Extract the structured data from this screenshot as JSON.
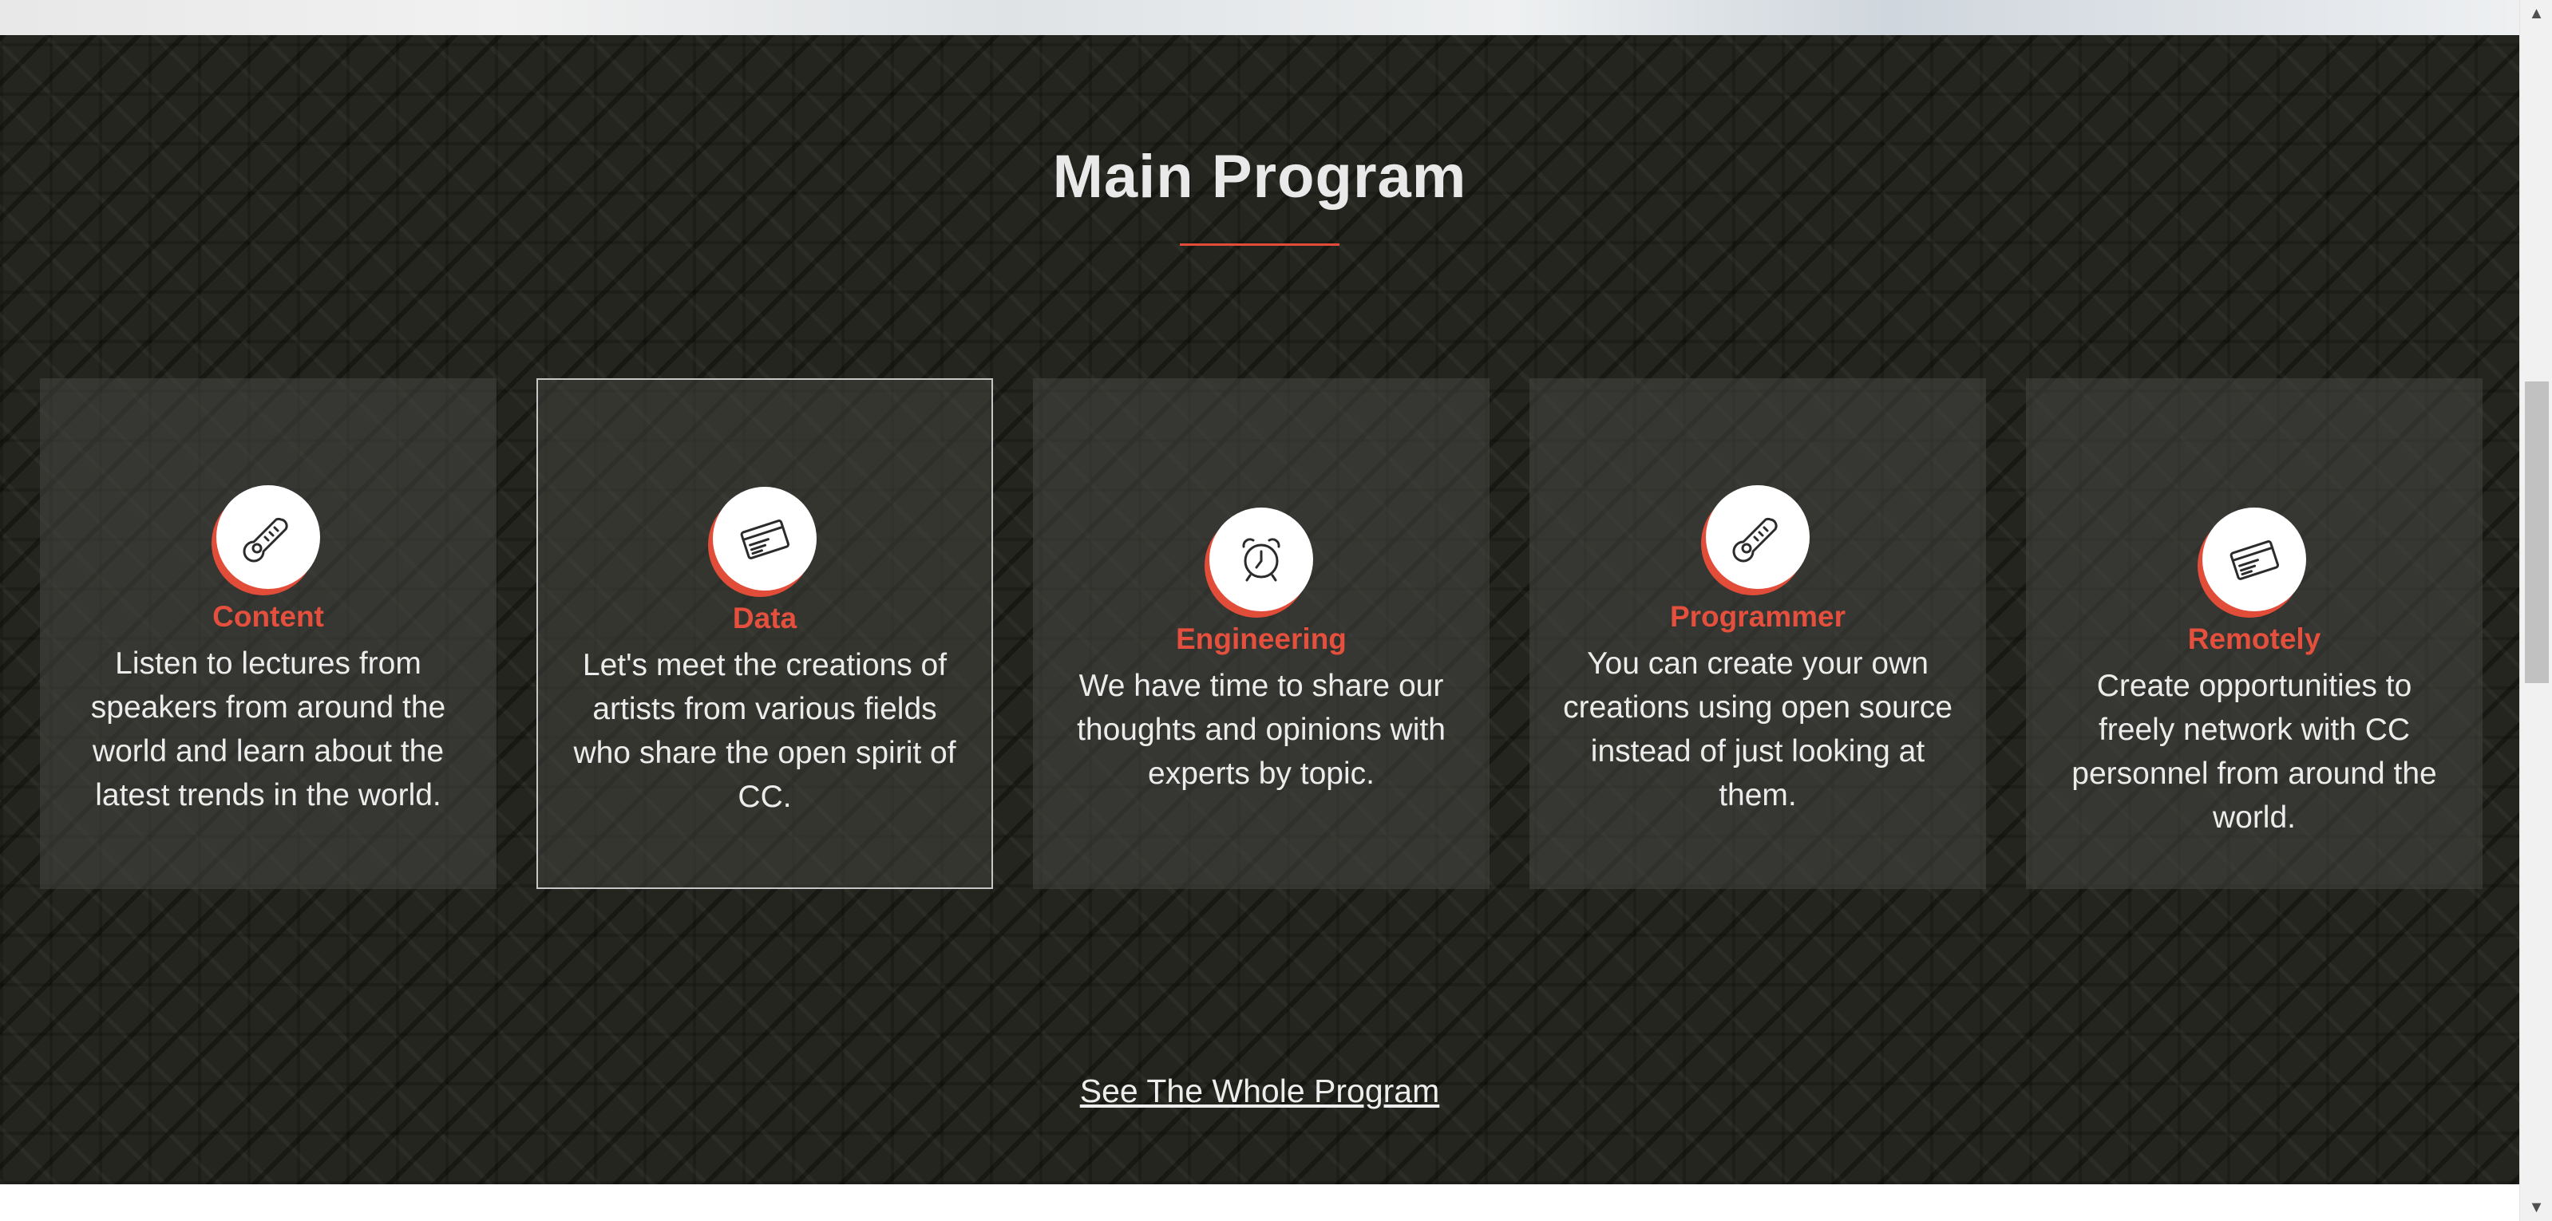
{
  "section": {
    "title": "Main Program",
    "link_label": "See The Whole Program"
  },
  "colors": {
    "accent": "#e24d3a",
    "background": "#24251f",
    "text": "#ececec"
  },
  "cards": [
    {
      "title": "Content",
      "text": "Listen to lectures from speakers from around the world and learn about the latest trends in the world.",
      "icon": "thermometer-icon",
      "selected": false
    },
    {
      "title": "Data",
      "text": "Let's meet the creations of artists from various fields who share the open spirit of CC.",
      "icon": "credit-card-icon",
      "selected": true
    },
    {
      "title": "Engineering",
      "text": "We have time to share our thoughts and opinions with experts by topic.",
      "icon": "alarm-clock-icon",
      "selected": false
    },
    {
      "title": "Programmer",
      "text": "You can create your own creations using open source instead of just looking at them.",
      "icon": "thermometer-icon",
      "selected": false
    },
    {
      "title": "Remotely",
      "text": "Create opportunities to freely network with CC personnel from around the world.",
      "icon": "credit-card-icon",
      "selected": false
    }
  ]
}
